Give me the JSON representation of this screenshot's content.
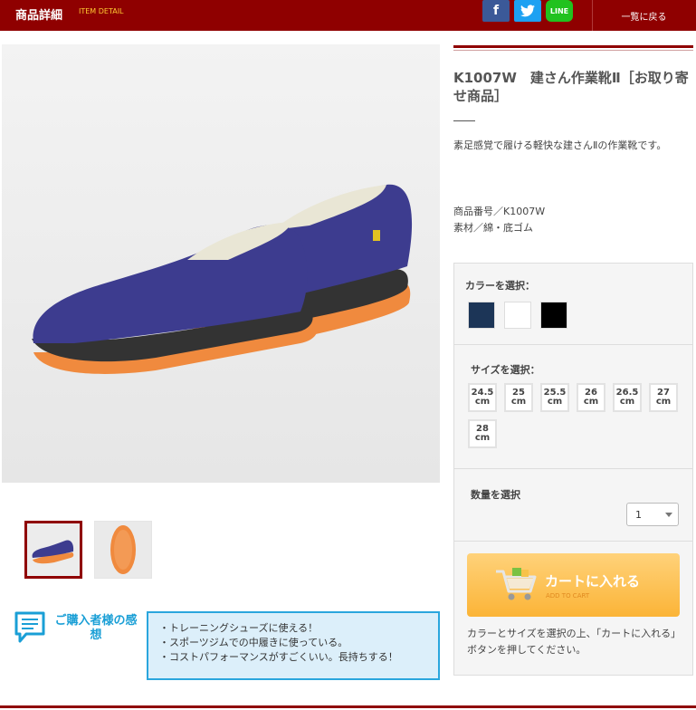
{
  "header": {
    "title": "商品詳細",
    "subtitle": "ITEM DETAIL",
    "share_facebook_icon": "f",
    "share_twitter_icon": "twitter-bird",
    "share_line_icon": "LINE",
    "back_label": "一覧に戻る"
  },
  "product": {
    "title": "K1007W　建さん作業靴Ⅱ［お取り寄せ商品］",
    "description": "素足感覚で履ける軽快な建さんⅡの作業靴です。",
    "code": "商品番号／K1007W",
    "material": "素材／綿・底ゴム",
    "shoe_color": "#3d3c8f",
    "sole_color": "#f08a3e"
  },
  "options": {
    "color_label": "カラーを選択：",
    "colors": [
      "#1c3557",
      "#ffffff",
      "#000000"
    ],
    "size_label": "サイズを選択：",
    "sizes": [
      {
        "num": "24.5",
        "unit": "cm"
      },
      {
        "num": "25",
        "unit": "cm"
      },
      {
        "num": "25.5",
        "unit": "cm"
      },
      {
        "num": "26",
        "unit": "cm"
      },
      {
        "num": "26.5",
        "unit": "cm"
      },
      {
        "num": "27",
        "unit": "cm"
      },
      {
        "num": "28",
        "unit": "cm"
      }
    ],
    "qty_label": "数量を選択",
    "qty_value": "1"
  },
  "cart": {
    "label": "カートに入れる",
    "sub": "ADD TO CART",
    "note": "カラーとサイズを選択の上、「カートに入れる」ボタンを押してください。"
  },
  "review": {
    "title": "ご購入者様の感想",
    "items": [
      "・トレーニングシューズに使える！",
      "・スポーツジムでの中履きに使っている。",
      "・コストパフォーマンスがすごくいい。長持ちする！"
    ]
  },
  "colors": {
    "brand": "#8f0000",
    "accent": "#ffcc33",
    "review_blue": "#2aa6dd",
    "cart_orange": "#fbb437"
  }
}
